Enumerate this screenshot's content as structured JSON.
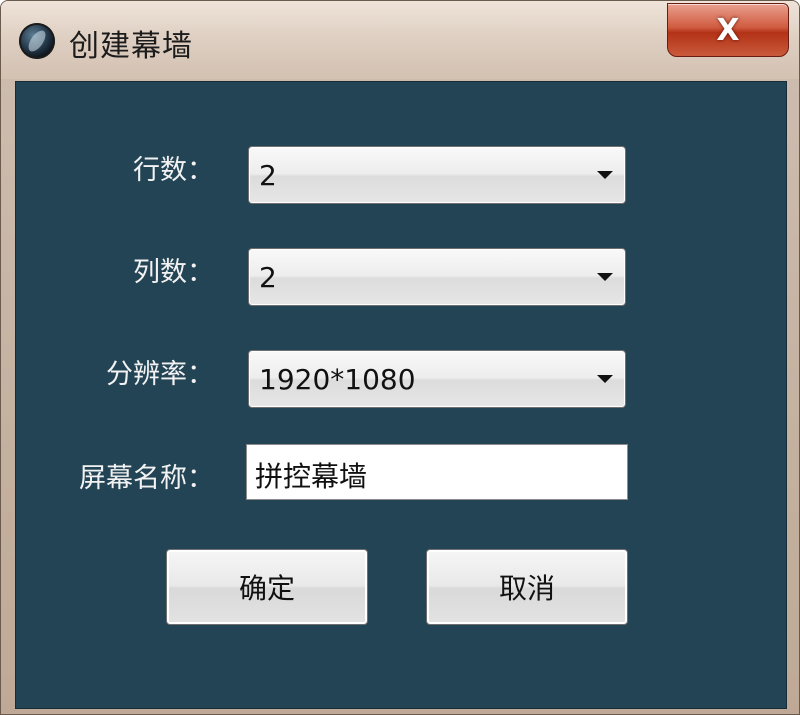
{
  "window": {
    "title": "创建幕墙",
    "close_label": "X",
    "app_icon": "app-logo-icon"
  },
  "form": {
    "rows_label": "行数：",
    "rows_value": "2",
    "cols_label": "列数：",
    "cols_value": "2",
    "resolution_label": "分辨率：",
    "resolution_value": "1920*1080",
    "screen_name_label": "屏幕名称：",
    "screen_name_value": "拼控幕墙"
  },
  "buttons": {
    "ok_label": "确定",
    "cancel_label": "取消"
  },
  "colors": {
    "client_bg": "#234455",
    "close_button": "#c0402a"
  }
}
